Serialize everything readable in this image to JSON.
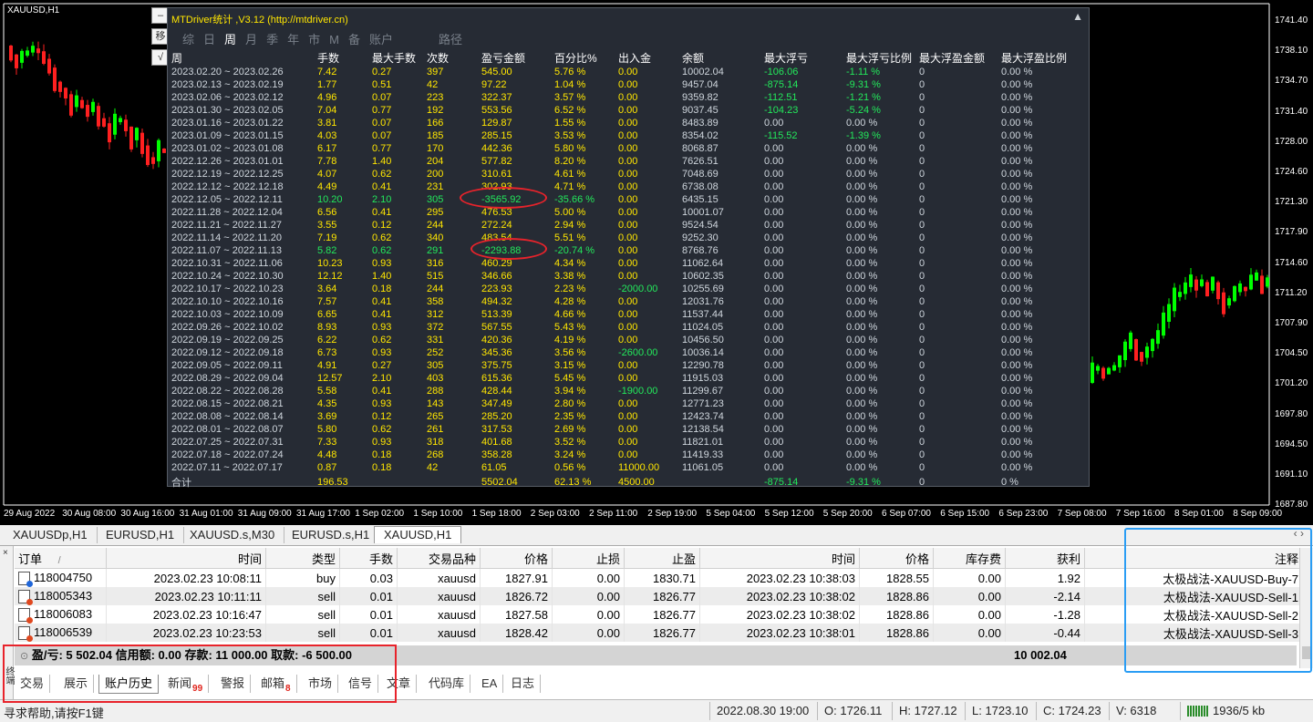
{
  "chart": {
    "symbol_label": "XAUUSD,H1",
    "price_labels": [
      "1741.40",
      "1738.10",
      "1734.70",
      "1731.40",
      "1728.00",
      "1724.60",
      "1721.30",
      "1717.90",
      "1714.60",
      "1711.20",
      "1707.90",
      "1704.50",
      "1701.20",
      "1697.80",
      "1694.50",
      "1691.10",
      "1687.80"
    ],
    "time_labels": [
      "29 Aug 2022",
      "30 Aug 08:00",
      "30 Aug 16:00",
      "31 Aug 01:00",
      "31 Aug 09:00",
      "31 Aug 17:00",
      "1 Sep 02:00",
      "1 Sep 10:00",
      "1 Sep 18:00",
      "2 Sep 03:00",
      "2 Sep 11:00",
      "2 Sep 19:00",
      "5 Sep 04:00",
      "5 Sep 12:00",
      "5 Sep 20:00",
      "6 Sep 07:00",
      "6 Sep 15:00",
      "6 Sep 23:00",
      "7 Sep 08:00",
      "7 Sep 16:00",
      "8 Sep 01:00",
      "8 Sep 09:00"
    ],
    "colors": {
      "bull": "#00ff00",
      "bear": "#ff2020",
      "background": "#000000",
      "axis": "#ffffff"
    }
  },
  "stats": {
    "title": "MTDriver统计 ,V3.12 (http://mtdriver.cn)",
    "close_icon": "▲",
    "side_buttons": [
      "–",
      "移",
      "√"
    ],
    "nav": [
      "综",
      "日",
      "周",
      "月",
      "季",
      "年",
      "市",
      "M",
      "备",
      "账户",
      "路径"
    ],
    "active_nav": "周",
    "headers": [
      "周",
      "手数",
      "最大手数",
      "次数",
      "盈亏金额",
      "百分比%",
      "出入金",
      "余额",
      "最大浮亏",
      "最大浮亏比例",
      "最大浮盈金额",
      "最大浮盈比例"
    ],
    "rows": [
      [
        "2023.02.20 ~ 2023.02.26",
        "7.42",
        "0.27",
        "397",
        "545.00",
        "5.76 %",
        "0.00",
        "10002.04",
        "-106.06",
        "-1.11 %",
        "0",
        "0.00 %"
      ],
      [
        "2023.02.13 ~ 2023.02.19",
        "1.77",
        "0.51",
        "42",
        "97.22",
        "1.04 %",
        "0.00",
        "9457.04",
        "-875.14",
        "-9.31 %",
        "0",
        "0.00 %"
      ],
      [
        "2023.02.06 ~ 2023.02.12",
        "4.96",
        "0.07",
        "223",
        "322.37",
        "3.57 %",
        "0.00",
        "9359.82",
        "-112.51",
        "-1.21 %",
        "0",
        "0.00 %"
      ],
      [
        "2023.01.30 ~ 2023.02.05",
        "7.04",
        "0.77",
        "192",
        "553.56",
        "6.52 %",
        "0.00",
        "9037.45",
        "-104.23",
        "-5.24 %",
        "0",
        "0.00 %"
      ],
      [
        "2023.01.16 ~ 2023.01.22",
        "3.81",
        "0.07",
        "166",
        "129.87",
        "1.55 %",
        "0.00",
        "8483.89",
        "0.00",
        "0.00 %",
        "0",
        "0.00 %"
      ],
      [
        "2023.01.09 ~ 2023.01.15",
        "4.03",
        "0.07",
        "185",
        "285.15",
        "3.53 %",
        "0.00",
        "8354.02",
        "-115.52",
        "-1.39 %",
        "0",
        "0.00 %"
      ],
      [
        "2023.01.02 ~ 2023.01.08",
        "6.17",
        "0.77",
        "170",
        "442.36",
        "5.80 %",
        "0.00",
        "8068.87",
        "0.00",
        "0.00 %",
        "0",
        "0.00 %"
      ],
      [
        "2022.12.26 ~ 2023.01.01",
        "7.78",
        "1.40",
        "204",
        "577.82",
        "8.20 %",
        "0.00",
        "7626.51",
        "0.00",
        "0.00 %",
        "0",
        "0.00 %"
      ],
      [
        "2022.12.19 ~ 2022.12.25",
        "4.07",
        "0.62",
        "200",
        "310.61",
        "4.61 %",
        "0.00",
        "7048.69",
        "0.00",
        "0.00 %",
        "0",
        "0.00 %"
      ],
      [
        "2022.12.12 ~ 2022.12.18",
        "4.49",
        "0.41",
        "231",
        "302.93",
        "4.71 %",
        "0.00",
        "6738.08",
        "0.00",
        "0.00 %",
        "0",
        "0.00 %"
      ],
      [
        "2022.12.05 ~ 2022.12.11",
        "10.20",
        "2.10",
        "305",
        "-3565.92",
        "-35.66 %",
        "0.00",
        "6435.15",
        "0.00",
        "0.00 %",
        "0",
        "0.00 %"
      ],
      [
        "2022.11.28 ~ 2022.12.04",
        "6.56",
        "0.41",
        "295",
        "476.53",
        "5.00 %",
        "0.00",
        "10001.07",
        "0.00",
        "0.00 %",
        "0",
        "0.00 %"
      ],
      [
        "2022.11.21 ~ 2022.11.27",
        "3.55",
        "0.12",
        "244",
        "272.24",
        "2.94 %",
        "0.00",
        "9524.54",
        "0.00",
        "0.00 %",
        "0",
        "0.00 %"
      ],
      [
        "2022.11.14 ~ 2022.11.20",
        "7.19",
        "0.62",
        "340",
        "483.54",
        "5.51 %",
        "0.00",
        "9252.30",
        "0.00",
        "0.00 %",
        "0",
        "0.00 %"
      ],
      [
        "2022.11.07 ~ 2022.11.13",
        "5.82",
        "0.62",
        "291",
        "-2293.88",
        "-20.74 %",
        "0.00",
        "8768.76",
        "0.00",
        "0.00 %",
        "0",
        "0.00 %"
      ],
      [
        "2022.10.31 ~ 2022.11.06",
        "10.23",
        "0.93",
        "316",
        "460.29",
        "4.34 %",
        "0.00",
        "11062.64",
        "0.00",
        "0.00 %",
        "0",
        "0.00 %"
      ],
      [
        "2022.10.24 ~ 2022.10.30",
        "12.12",
        "1.40",
        "515",
        "346.66",
        "3.38 %",
        "0.00",
        "10602.35",
        "0.00",
        "0.00 %",
        "0",
        "0.00 %"
      ],
      [
        "2022.10.17 ~ 2022.10.23",
        "3.64",
        "0.18",
        "244",
        "223.93",
        "2.23 %",
        "-2000.00",
        "10255.69",
        "0.00",
        "0.00 %",
        "0",
        "0.00 %"
      ],
      [
        "2022.10.10 ~ 2022.10.16",
        "7.57",
        "0.41",
        "358",
        "494.32",
        "4.28 %",
        "0.00",
        "12031.76",
        "0.00",
        "0.00 %",
        "0",
        "0.00 %"
      ],
      [
        "2022.10.03 ~ 2022.10.09",
        "6.65",
        "0.41",
        "312",
        "513.39",
        "4.66 %",
        "0.00",
        "11537.44",
        "0.00",
        "0.00 %",
        "0",
        "0.00 %"
      ],
      [
        "2022.09.26 ~ 2022.10.02",
        "8.93",
        "0.93",
        "372",
        "567.55",
        "5.43 %",
        "0.00",
        "11024.05",
        "0.00",
        "0.00 %",
        "0",
        "0.00 %"
      ],
      [
        "2022.09.19 ~ 2022.09.25",
        "6.22",
        "0.62",
        "331",
        "420.36",
        "4.19 %",
        "0.00",
        "10456.50",
        "0.00",
        "0.00 %",
        "0",
        "0.00 %"
      ],
      [
        "2022.09.12 ~ 2022.09.18",
        "6.73",
        "0.93",
        "252",
        "345.36",
        "3.56 %",
        "-2600.00",
        "10036.14",
        "0.00",
        "0.00 %",
        "0",
        "0.00 %"
      ],
      [
        "2022.09.05 ~ 2022.09.11",
        "4.91",
        "0.27",
        "305",
        "375.75",
        "3.15 %",
        "0.00",
        "12290.78",
        "0.00",
        "0.00 %",
        "0",
        "0.00 %"
      ],
      [
        "2022.08.29 ~ 2022.09.04",
        "12.57",
        "2.10",
        "403",
        "615.36",
        "5.45 %",
        "0.00",
        "11915.03",
        "0.00",
        "0.00 %",
        "0",
        "0.00 %"
      ],
      [
        "2022.08.22 ~ 2022.08.28",
        "5.58",
        "0.41",
        "288",
        "428.44",
        "3.94 %",
        "-1900.00",
        "11299.67",
        "0.00",
        "0.00 %",
        "0",
        "0.00 %"
      ],
      [
        "2022.08.15 ~ 2022.08.21",
        "4.35",
        "0.93",
        "143",
        "347.49",
        "2.80 %",
        "0.00",
        "12771.23",
        "0.00",
        "0.00 %",
        "0",
        "0.00 %"
      ],
      [
        "2022.08.08 ~ 2022.08.14",
        "3.69",
        "0.12",
        "265",
        "285.20",
        "2.35 %",
        "0.00",
        "12423.74",
        "0.00",
        "0.00 %",
        "0",
        "0.00 %"
      ],
      [
        "2022.08.01 ~ 2022.08.07",
        "5.80",
        "0.62",
        "261",
        "317.53",
        "2.69 %",
        "0.00",
        "12138.54",
        "0.00",
        "0.00 %",
        "0",
        "0.00 %"
      ],
      [
        "2022.07.25 ~ 2022.07.31",
        "7.33",
        "0.93",
        "318",
        "401.68",
        "3.52 %",
        "0.00",
        "11821.01",
        "0.00",
        "0.00 %",
        "0",
        "0.00 %"
      ],
      [
        "2022.07.18 ~ 2022.07.24",
        "4.48",
        "0.18",
        "268",
        "358.28",
        "3.24 %",
        "0.00",
        "11419.33",
        "0.00",
        "0.00 %",
        "0",
        "0.00 %"
      ],
      [
        "2022.07.11 ~ 2022.07.17",
        "0.87",
        "0.18",
        "42",
        "61.05",
        "0.56 %",
        "11000.00",
        "11061.05",
        "0.00",
        "0.00 %",
        "0",
        "0.00 %"
      ]
    ],
    "total": [
      "合计",
      "196.53",
      "",
      "",
      "5502.04",
      "62.13 %",
      "4500.00",
      "",
      "-875.14",
      "-9.31 %",
      "0",
      "0 %"
    ],
    "colors": {
      "bg": "#262b34",
      "yellow": "#ffe600",
      "green": "#23e85b",
      "text": "#cfd6dd",
      "highlight": "#e8232b"
    }
  },
  "chart_tabs": [
    "XAUUSDp,H1",
    "EURUSD,H1",
    "XAUUSD.s,M30",
    "EURUSD.s,H1",
    "XAUUSD,H1"
  ],
  "chart_tabs_active": "XAUUSD,H1",
  "chart_tabs_arrows": "‹ ›",
  "terminal": {
    "close_icon": "×",
    "side_label": "终端",
    "headers": [
      "订单",
      "/",
      "时间",
      "类型",
      "手数",
      "交易品种",
      "价格",
      "止损",
      "止盈",
      "时间",
      "价格",
      "库存费",
      "获利",
      "注释"
    ],
    "rows": [
      {
        "icon": "buy",
        "order": "118004750",
        "open_time": "2023.02.23 10:08:11",
        "type": "buy",
        "lots": "0.03",
        "symbol": "xauusd",
        "price": "1827.91",
        "sl": "0.00",
        "tp": "1830.71",
        "close_time": "2023.02.23 10:38:03",
        "close_price": "1828.55",
        "swap": "0.00",
        "profit": "1.92",
        "comment": "太极战法-XAUUSD-Buy-7"
      },
      {
        "icon": "sell",
        "order": "118005343",
        "open_time": "2023.02.23 10:11:11",
        "type": "sell",
        "lots": "0.01",
        "symbol": "xauusd",
        "price": "1826.72",
        "sl": "0.00",
        "tp": "1826.77",
        "close_time": "2023.02.23 10:38:02",
        "close_price": "1828.86",
        "swap": "0.00",
        "profit": "-2.14",
        "comment": "太极战法-XAUUSD-Sell-1"
      },
      {
        "icon": "sell",
        "order": "118006083",
        "open_time": "2023.02.23 10:16:47",
        "type": "sell",
        "lots": "0.01",
        "symbol": "xauusd",
        "price": "1827.58",
        "sl": "0.00",
        "tp": "1826.77",
        "close_time": "2023.02.23 10:38:02",
        "close_price": "1828.86",
        "swap": "0.00",
        "profit": "-1.28",
        "comment": "太极战法-XAUUSD-Sell-2"
      },
      {
        "icon": "sell",
        "order": "118006539",
        "open_time": "2023.02.23 10:23:53",
        "type": "sell",
        "lots": "0.01",
        "symbol": "xauusd",
        "price": "1828.42",
        "sl": "0.00",
        "tp": "1826.77",
        "close_time": "2023.02.23 10:38:01",
        "close_price": "1828.86",
        "swap": "0.00",
        "profit": "-0.44",
        "comment": "太极战法-XAUUSD-Sell-3"
      }
    ],
    "summary": "盈/亏: 5 502.04  信用额: 0.00  存款: 11 000.00  取款: -6 500.00",
    "summary_icon": "⊙",
    "summary_balance": "10 002.04",
    "tabs": [
      {
        "label": "交易",
        "badge": ""
      },
      {
        "label": "展示",
        "badge": ""
      },
      {
        "label": "账户历史",
        "badge": ""
      },
      {
        "label": "新闻",
        "badge": "99"
      },
      {
        "label": "警报",
        "badge": ""
      },
      {
        "label": "邮箱",
        "badge": "8"
      },
      {
        "label": "市场",
        "badge": ""
      },
      {
        "label": "信号",
        "badge": ""
      },
      {
        "label": "文章",
        "badge": ""
      },
      {
        "label": "代码库",
        "badge": ""
      },
      {
        "label": "EA",
        "badge": ""
      },
      {
        "label": "日志",
        "badge": ""
      }
    ],
    "active_tab": "账户历史"
  },
  "status": {
    "help": "寻求帮助,请按F1键",
    "datetime": "2022.08.30 19:00",
    "open": "O: 1726.11",
    "high": "H: 1727.12",
    "low": "L: 1723.10",
    "close": "C: 1724.23",
    "volume": "V: 6318",
    "traffic": "1936/5 kb"
  }
}
